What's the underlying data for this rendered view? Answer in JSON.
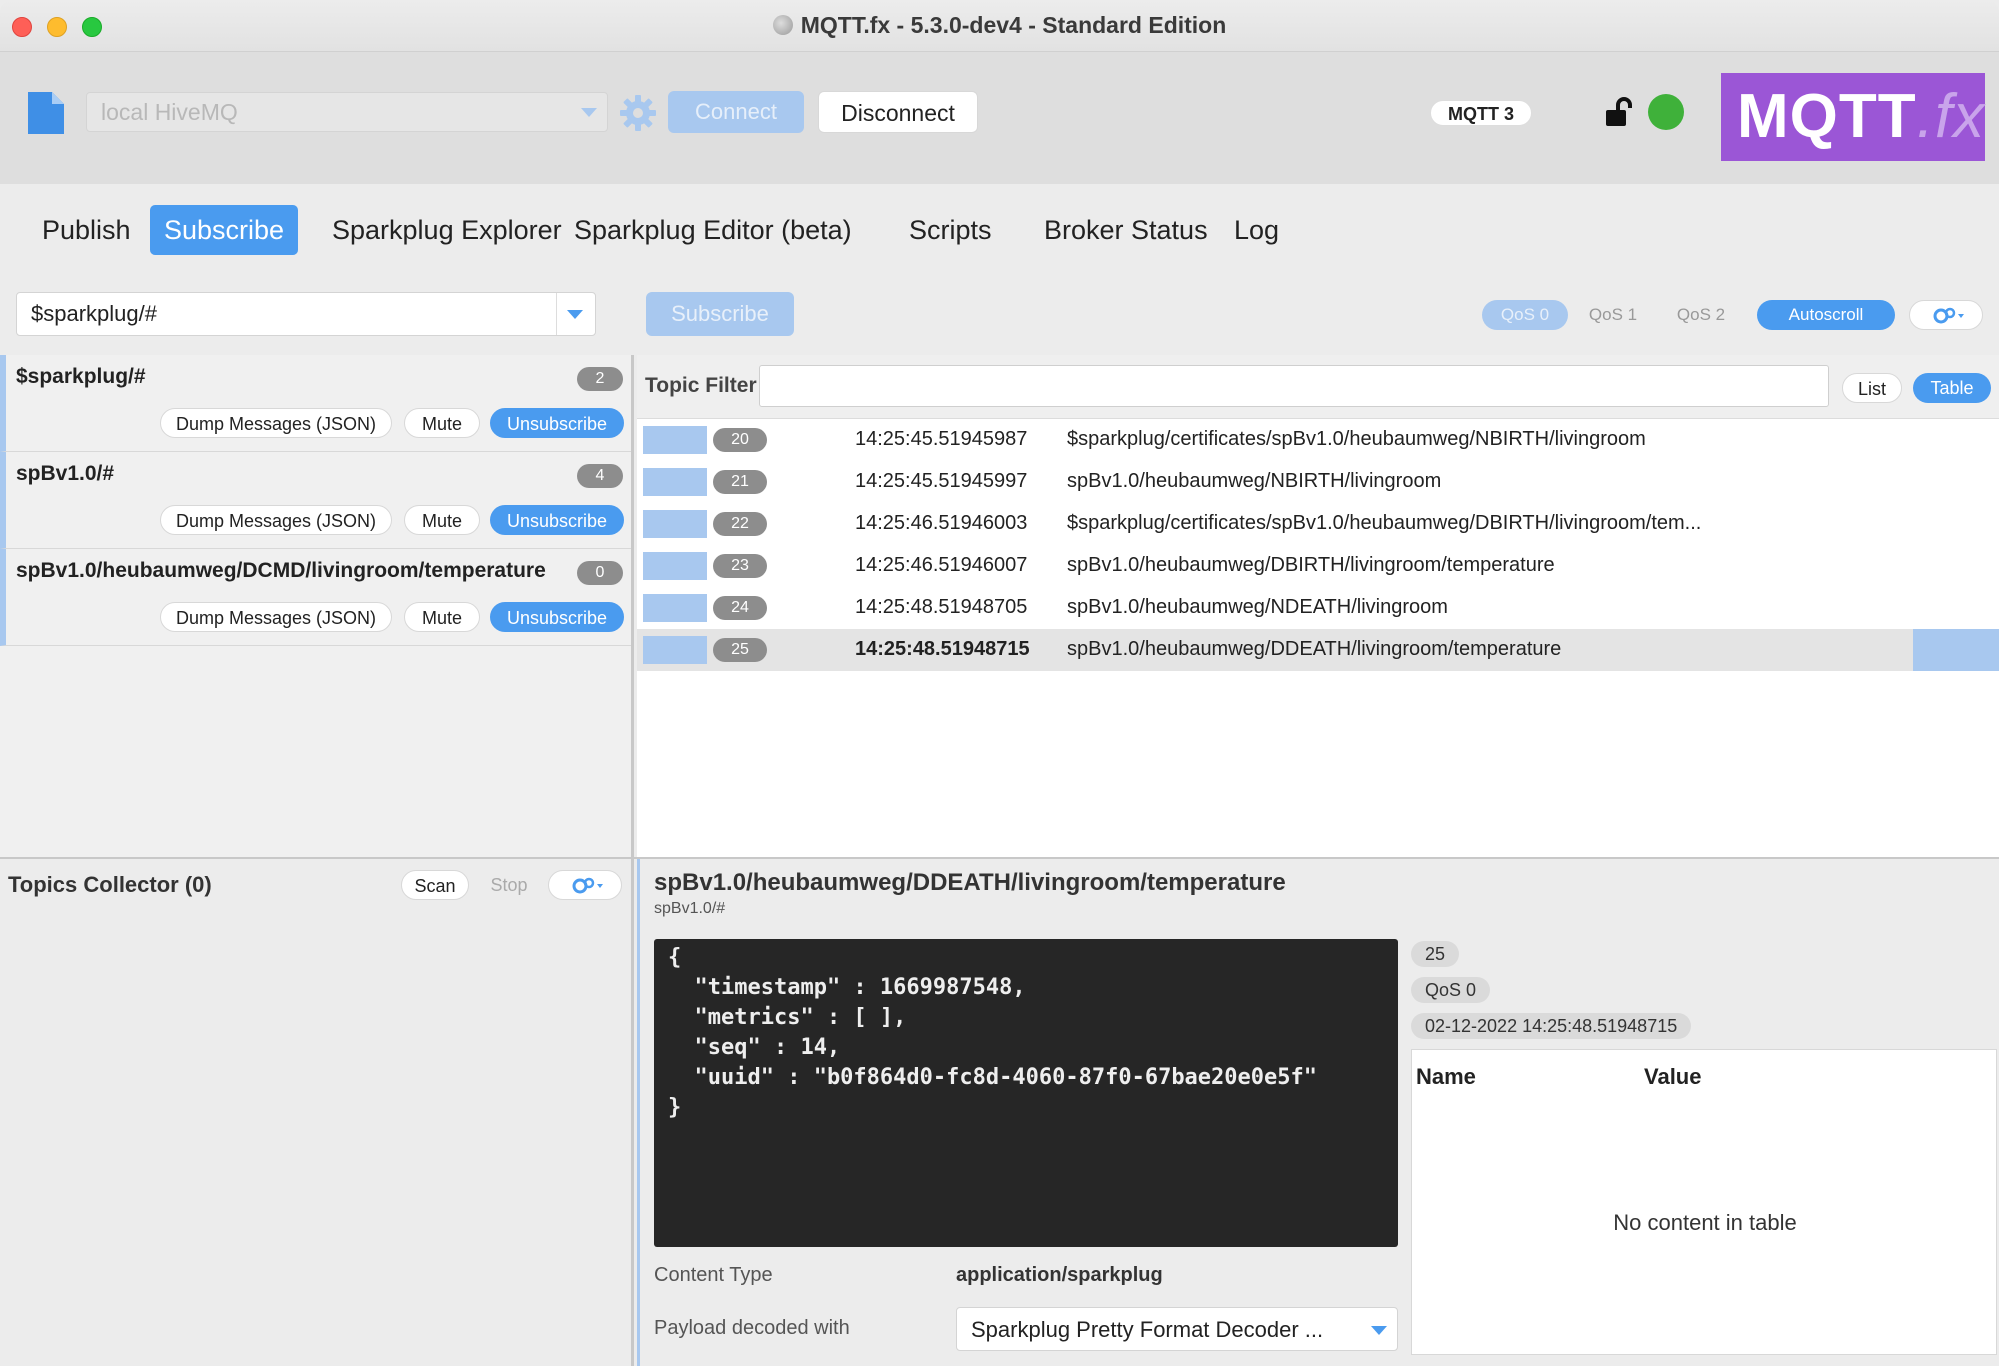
{
  "window": {
    "title": "MQTT.fx - 5.3.0-dev4 - Standard Edition"
  },
  "toolbar": {
    "connection_profile": "local HiveMQ",
    "connect_label": "Connect",
    "disconnect_label": "Disconnect",
    "protocol_badge": "MQTT 3",
    "status_color": "#3fb13a",
    "logo_main": "MQTT",
    "logo_suffix": ".fx"
  },
  "tabs": [
    {
      "label": "Publish",
      "active": false
    },
    {
      "label": "Subscribe",
      "active": true
    },
    {
      "label": "Sparkplug Explorer",
      "active": false
    },
    {
      "label": "Sparkplug Editor (beta)",
      "active": false
    },
    {
      "label": "Scripts",
      "active": false
    },
    {
      "label": "Broker Status",
      "active": false
    },
    {
      "label": "Log",
      "active": false
    }
  ],
  "subscribe_bar": {
    "topic_value": "$sparkplug/#",
    "subscribe_label": "Subscribe",
    "qos0": "QoS 0",
    "qos1": "QoS 1",
    "qos2": "QoS 2",
    "autoscroll": "Autoscroll"
  },
  "subscriptions": [
    {
      "topic": "$sparkplug/#",
      "count": "2",
      "dump": "Dump Messages (JSON)",
      "mute": "Mute",
      "unsubscribe": "Unsubscribe"
    },
    {
      "topic": "spBv1.0/#",
      "count": "4",
      "dump": "Dump Messages (JSON)",
      "mute": "Mute",
      "unsubscribe": "Unsubscribe"
    },
    {
      "topic": "spBv1.0/heubaumweg/DCMD/livingroom/temperature",
      "count": "0",
      "dump": "Dump Messages (JSON)",
      "mute": "Mute",
      "unsubscribe": "Unsubscribe"
    }
  ],
  "message_list": {
    "filter_label": "Topic Filter",
    "filter_value": "",
    "list_label": "List",
    "table_label": "Table",
    "rows": [
      {
        "num": "20",
        "time": "14:25:45.51945987",
        "topic": "$sparkplug/certificates/spBv1.0/heubaumweg/NBIRTH/livingroom",
        "selected": false
      },
      {
        "num": "21",
        "time": "14:25:45.51945997",
        "topic": "spBv1.0/heubaumweg/NBIRTH/livingroom",
        "selected": false
      },
      {
        "num": "22",
        "time": "14:25:46.51946003",
        "topic": "$sparkplug/certificates/spBv1.0/heubaumweg/DBIRTH/livingroom/tem...",
        "selected": false
      },
      {
        "num": "23",
        "time": "14:25:46.51946007",
        "topic": "spBv1.0/heubaumweg/DBIRTH/livingroom/temperature",
        "selected": false
      },
      {
        "num": "24",
        "time": "14:25:48.51948705",
        "topic": "spBv1.0/heubaumweg/NDEATH/livingroom",
        "selected": false
      },
      {
        "num": "25",
        "time": "14:25:48.51948715",
        "topic": "spBv1.0/heubaumweg/DDEATH/livingroom/temperature",
        "selected": true
      }
    ]
  },
  "collector": {
    "title": "Topics Collector (0)",
    "scan_label": "Scan",
    "stop_label": "Stop"
  },
  "detail": {
    "topic": "spBv1.0/heubaumweg/DDEATH/livingroom/temperature",
    "subscription": "spBv1.0/#",
    "payload": "{\n  \"timestamp\" : 1669987548,\n  \"metrics\" : [ ],\n  \"seq\" : 14,\n  \"uuid\" : \"b0f864d0-fc8d-4060-87f0-67bae20e0e5f\"\n}",
    "msg_number": "25",
    "qos": "QoS 0",
    "datetime": "02-12-2022  14:25:48.51948715",
    "table_name_header": "Name",
    "table_value_header": "Value",
    "table_empty": "No content in table",
    "content_type_label": "Content Type",
    "content_type_value": "application/sparkplug",
    "decoder_label": "Payload decoded with",
    "decoder_value": "Sparkplug Pretty Format Decoder ..."
  }
}
